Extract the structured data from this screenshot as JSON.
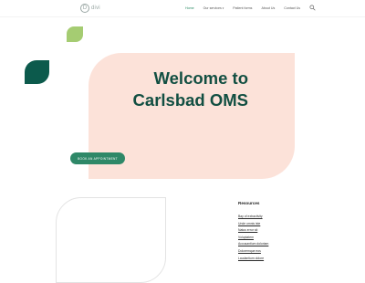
{
  "header": {
    "logo_glyph": "D",
    "logo_text": "divi",
    "nav": [
      {
        "label": "Home",
        "active": true
      },
      {
        "label": "Our services",
        "has_dropdown": true,
        "caret": "▾"
      },
      {
        "label": "Patient forms"
      },
      {
        "label": "About Us"
      },
      {
        "label": "Contact Us"
      }
    ],
    "search_icon": "search-icon"
  },
  "hero": {
    "title": "Welcome to Carlsbad OMS",
    "cta_label": "Book an appointment"
  },
  "resources": {
    "title": "Resources",
    "links": [
      "Bay of extractivity",
      "Unde omnis iste",
      "Natus error sit",
      "Voluptatem",
      "Accusantium doloriam",
      "Doloremque eos",
      "Laudantium dolore"
    ]
  },
  "colors": {
    "accent_green": "#2e8868",
    "dark_green": "#0c5a4c",
    "light_green": "#a5cc72",
    "peach": "#fce2d9",
    "title_text": "#124f42"
  }
}
